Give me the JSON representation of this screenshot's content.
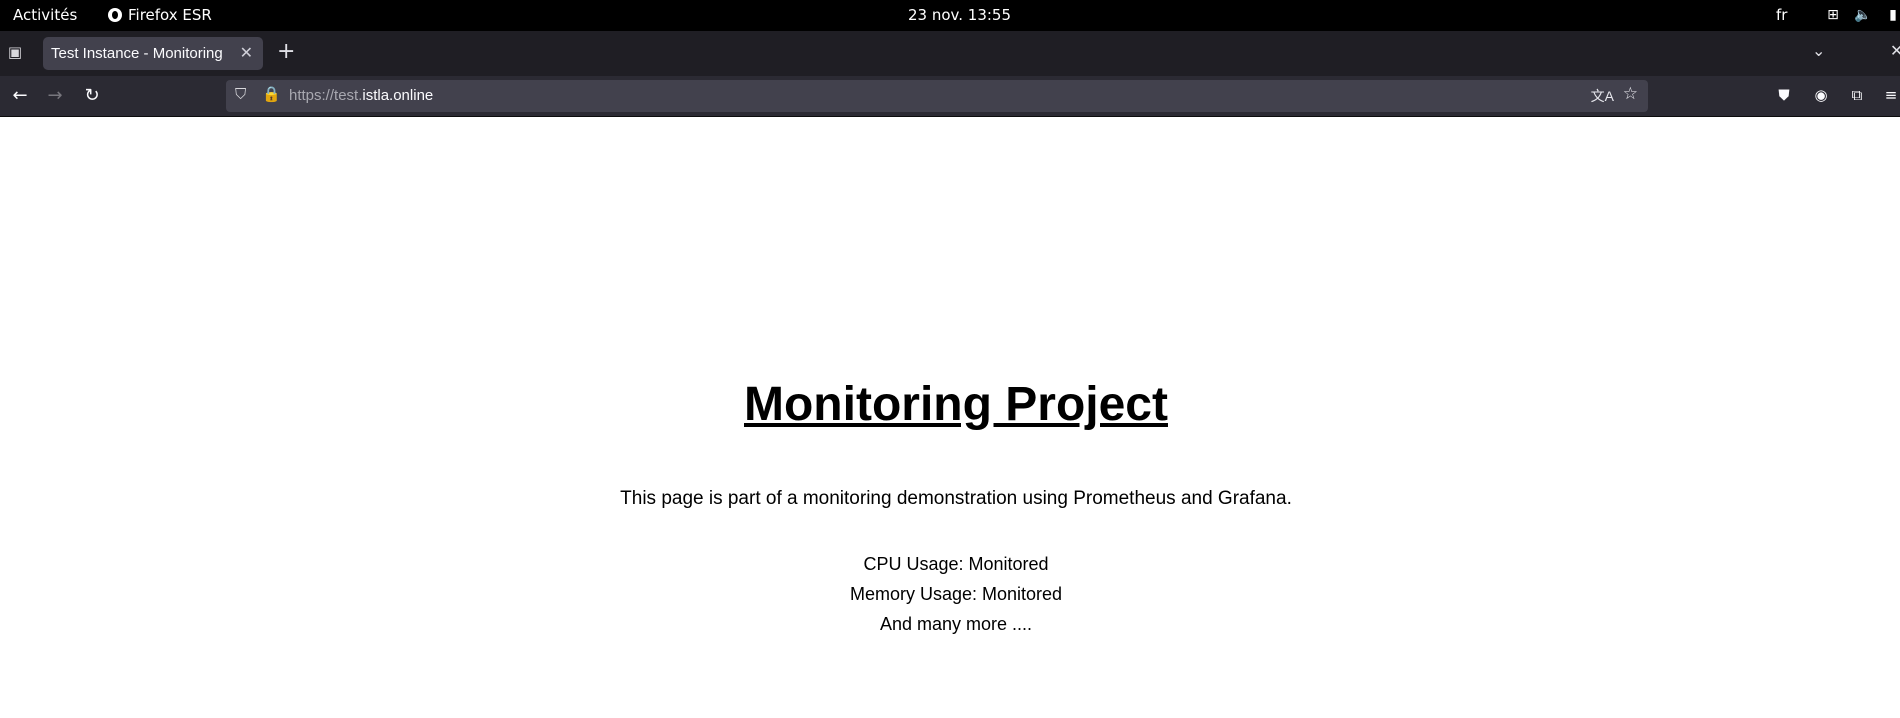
{
  "topbar": {
    "activities": "Activités",
    "app_name": "Firefox ESR",
    "clock": "23 nov.  13:55",
    "lang": "fr",
    "tray_icons": [
      "network-icon",
      "volume-icon",
      "battery-icon"
    ]
  },
  "tabs": [
    {
      "label": "Test Instance - Monitoring",
      "active": true
    }
  ],
  "navbar": {
    "url_prefix": "https://test.",
    "url_domain": "istla.online",
    "right_icons": [
      "pocket-icon",
      "account-icon",
      "extensions-icon",
      "menu-icon"
    ]
  },
  "page": {
    "title": "Monitoring Project",
    "description": "This page is part of a monitoring demonstration using Prometheus and Grafana.",
    "lines": [
      "CPU Usage: Monitored",
      "Memory Usage: Monitored",
      "And many more ...."
    ]
  },
  "colors": {
    "topbar_bg": "#000000",
    "tabstrip_bg": "#1f1e24",
    "active_tab_bg": "#42414d",
    "navbar_bg": "#2b2a33",
    "page_bg": "#ffffff"
  }
}
